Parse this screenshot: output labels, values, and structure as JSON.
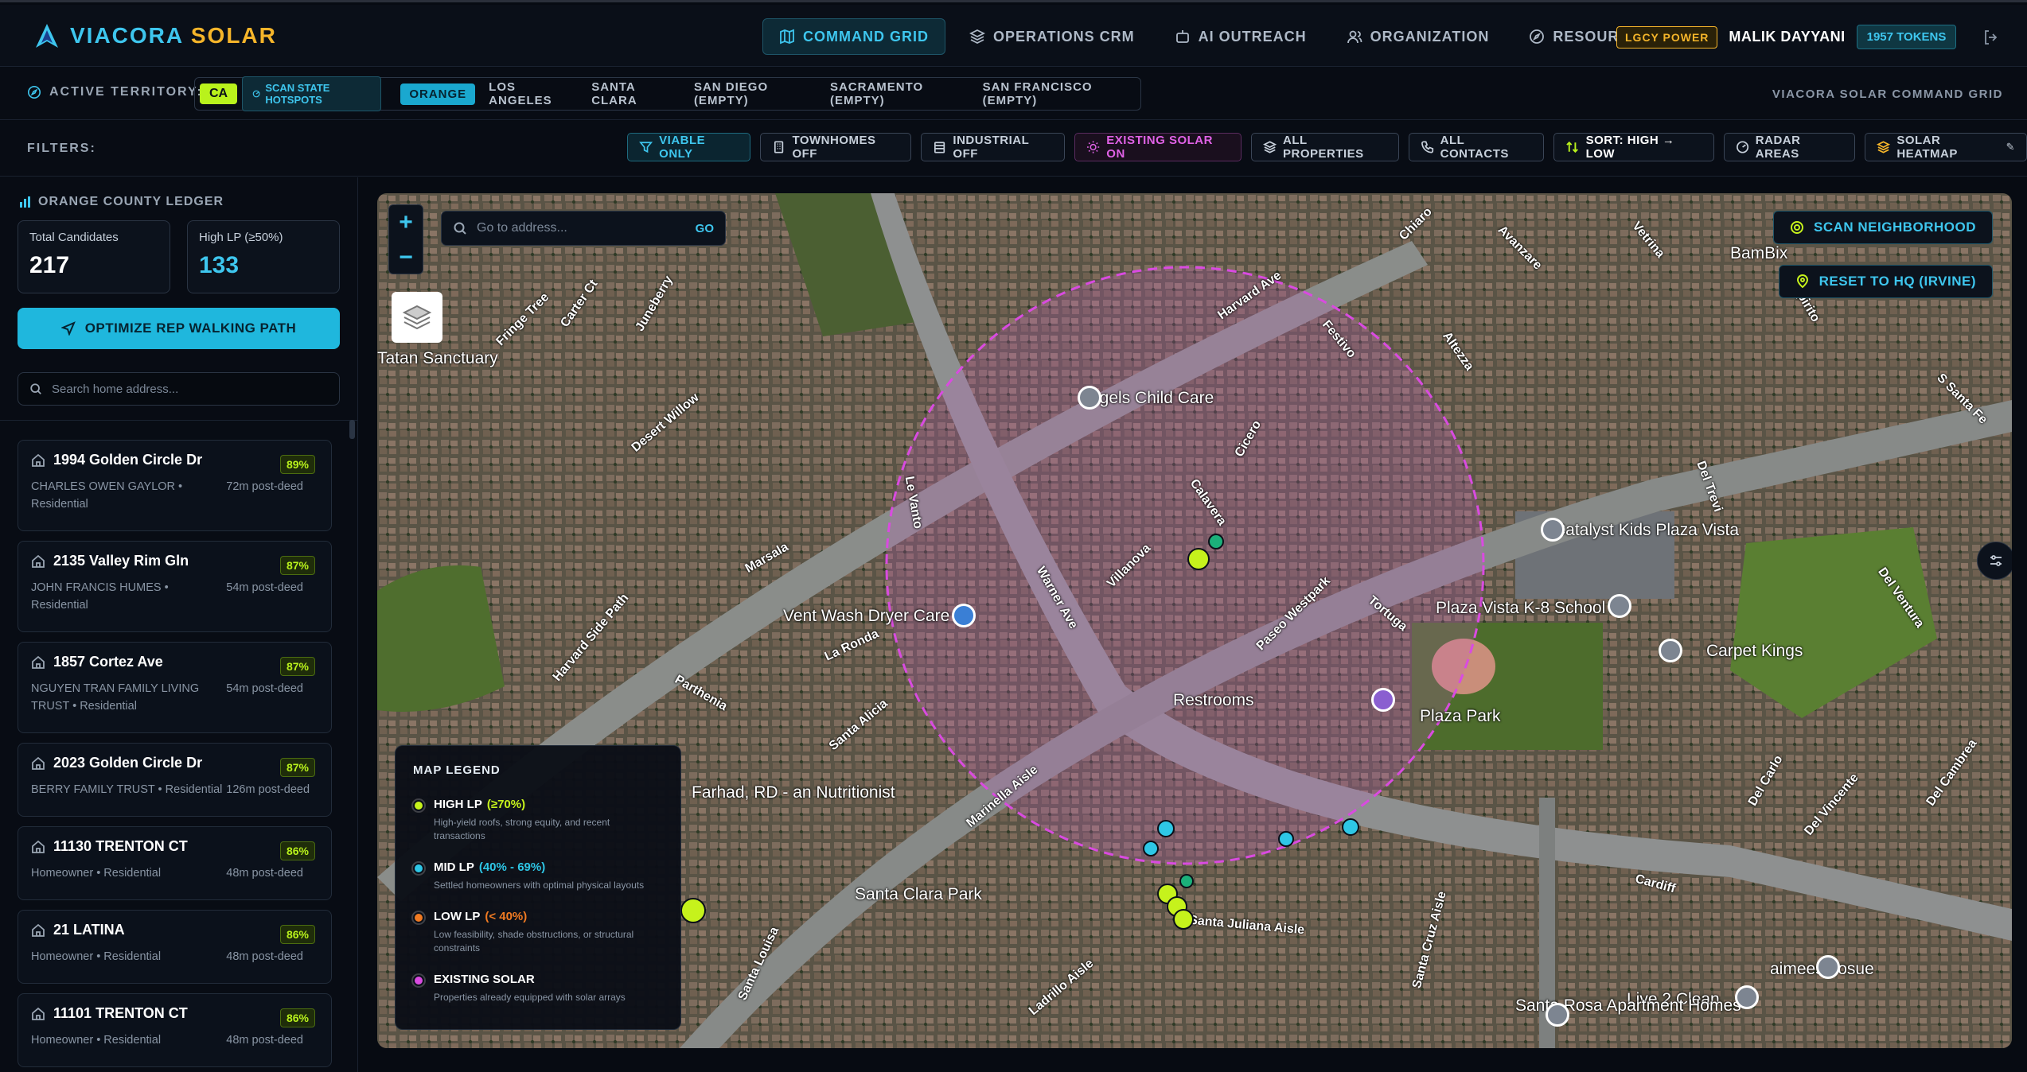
{
  "brand": {
    "part1": "VIACORA",
    "part2": "SOLAR"
  },
  "nav": [
    {
      "label": "COMMAND GRID",
      "active": true,
      "icon": "map-icon"
    },
    {
      "label": "OPERATIONS CRM",
      "active": false,
      "icon": "layers-icon"
    },
    {
      "label": "AI OUTREACH",
      "active": false,
      "icon": "robot-icon"
    },
    {
      "label": "ORGANIZATION",
      "active": false,
      "icon": "users-icon"
    },
    {
      "label": "RESOURCES",
      "active": false,
      "icon": "compass-icon"
    }
  ],
  "user": {
    "badge": "LGCY POWER",
    "name": "MALIK DAYYANI",
    "tokens": "1957 TOKENS"
  },
  "territory": {
    "label": "ACTIVE TERRITORY:",
    "state": "CA",
    "scan_label": "SCAN STATE HOTSPOTS",
    "counties": [
      "ORANGE",
      "LOS ANGELES",
      "SANTA CLARA",
      "SAN DIEGO (EMPTY)",
      "SACRAMENTO (EMPTY)",
      "SAN FRANCISCO (EMPTY)"
    ],
    "active_county": "ORANGE",
    "right_label": "VIACORA SOLAR COMMAND GRID"
  },
  "filters": {
    "label": "FILTERS:",
    "buttons": [
      "VIABLE ONLY",
      "TOWNHOMES OFF",
      "INDUSTRIAL OFF",
      "EXISTING SOLAR ON",
      "ALL PROPERTIES",
      "ALL CONTACTS",
      "SORT: HIGH → LOW",
      "RADAR AREAS",
      "SOLAR HEATMAP"
    ]
  },
  "ledger": {
    "title": "ORANGE COUNTY LEDGER",
    "total_label": "Total Candidates",
    "total_value": "217",
    "high_label": "High LP (≥50%)",
    "high_value": "133",
    "optimize_label": "OPTIMIZE REP WALKING PATH",
    "search_placeholder": "Search home address...",
    "items": [
      {
        "address": "1994 Golden Circle Dr",
        "pct": "89%",
        "owner": "CHARLES OWEN GAYLOR • Residential",
        "deed": "72m post-deed"
      },
      {
        "address": "2135 Valley Rim Gln",
        "pct": "87%",
        "owner": "JOHN FRANCIS HUMES • Residential",
        "deed": "54m post-deed"
      },
      {
        "address": "1857 Cortez Ave",
        "pct": "87%",
        "owner": "NGUYEN TRAN FAMILY LIVING TRUST • Residential",
        "deed": "54m post-deed"
      },
      {
        "address": "2023 Golden Circle Dr",
        "pct": "87%",
        "owner": "BERRY FAMILY TRUST • Residential",
        "deed": "126m post-deed"
      },
      {
        "address": "11130 TRENTON CT",
        "pct": "86%",
        "owner": "Homeowner • Residential",
        "deed": "48m post-deed"
      },
      {
        "address": "21 LATINA",
        "pct": "86%",
        "owner": "Homeowner • Residential",
        "deed": "48m post-deed"
      },
      {
        "address": "11101 TRENTON CT",
        "pct": "86%",
        "owner": "Homeowner • Residential",
        "deed": "48m post-deed"
      }
    ]
  },
  "map": {
    "search_placeholder": "Go to address...",
    "go_label": "GO",
    "scan_label": "SCAN NEIGHBORHOOD",
    "reset_label": "RESET TO HQ (IRVINE)",
    "legend": {
      "title": "MAP LEGEND",
      "items": [
        {
          "title": "HIGH LP",
          "range": "(≥70%)",
          "desc": "High-yield roofs, strong equity, and recent transactions",
          "color": "#c6f21c"
        },
        {
          "title": "MID LP",
          "range": "(40% - 69%)",
          "desc": "Settled homeowners with optimal physical layouts",
          "color": "#2ec7e6"
        },
        {
          "title": "LOW LP",
          "range": "(< 40%)",
          "desc": "Low feasibility, shade obstructions, or structural constraints",
          "color": "#f07a22"
        },
        {
          "title": "EXISTING SOLAR",
          "range": "",
          "desc": "Properties already equipped with solar arrays",
          "color": "#d94be0"
        }
      ]
    },
    "places": [
      "Angels Child Care",
      "Catalyst Kids Plaza Vista",
      "Plaza Vista K-8 School",
      "Carpet Kings",
      "Restrooms",
      "Plaza Park",
      "Vent Wash Dryer Care",
      "Tatan Sanctuary",
      "BamBix",
      "Santa Clara Park",
      "aimees hosue",
      "Live 2 Clean",
      "Santa Rosa Apartment Homes",
      "Farhad, RD - an Nutritionist"
    ],
    "streets": [
      "Harvard Ave",
      "Warner Ave",
      "Paseo Westpark",
      "Santa Juliana Aisle",
      "Desert Willow",
      "Fringe Tree",
      "Carter Ct",
      "Juneberry",
      "Festivo",
      "Chiaro",
      "Avanzare",
      "Vetrina",
      "Spirito",
      "Altezza",
      "Cicero",
      "Calavera",
      "Villanova",
      "Tortuga",
      "Le Vanto",
      "Marsala",
      "La Ronda",
      "Parthenia",
      "Santa Alicia",
      "Marinella Aisle",
      "Harvard Side Path",
      "Cardiff",
      "Del Carlo",
      "Del Vincente",
      "Del Cambrea",
      "Del Ventura",
      "S Santa Fe",
      "Del Trevi",
      "Ladrillo Aisle",
      "Santa Cruz Aisle",
      "Santa Louisa"
    ]
  }
}
